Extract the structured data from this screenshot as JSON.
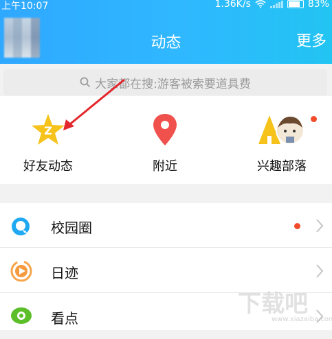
{
  "status": {
    "time": "上午10:07",
    "speed": "1.36K/s",
    "battery": "83%"
  },
  "header": {
    "title": "动态",
    "more": "更多"
  },
  "search": {
    "text": "大家都在搜:游客被索要道具费"
  },
  "quick": {
    "items": [
      {
        "label": "好友动态",
        "icon": "star-qzone-icon"
      },
      {
        "label": "附近",
        "icon": "location-pin-icon"
      },
      {
        "label": "兴趣部落",
        "icon": "tribe-icon"
      }
    ]
  },
  "list": {
    "items": [
      {
        "label": "校园圈",
        "icon": "campus-circle-icon",
        "badge": true
      },
      {
        "label": "日迹",
        "icon": "daily-video-icon",
        "badge": false
      },
      {
        "label": "看点",
        "icon": "eye-icon",
        "badge": false
      }
    ]
  },
  "watermark": {
    "text": "下载吧",
    "url": "www.xiazaiba.com"
  },
  "colors": {
    "header": "#2fb0ff",
    "accent_red": "#f24b2b",
    "annotation_arrow": "#e3262b"
  }
}
